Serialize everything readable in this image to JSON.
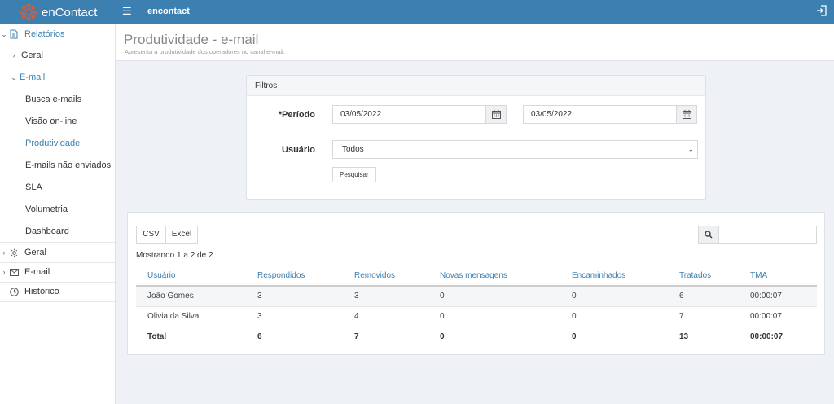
{
  "app": {
    "brand": "enContact",
    "title": "encontact"
  },
  "sidebar": {
    "reports": "Relatórios",
    "geral_sub": "Geral",
    "email_sub": "E-mail",
    "email_items": [
      "Busca e-mails",
      "Visão on-line",
      "Produtividade",
      "E-mails não enviados",
      "SLA",
      "Volumetria",
      "Dashboard"
    ],
    "geral": "Geral",
    "email": "E-mail",
    "historico": "Histórico"
  },
  "page": {
    "title": "Produtividade - e-mail",
    "subtitle": "Apresenta a produtividade dos operadores no canal e-mail."
  },
  "filters": {
    "heading": "Filtros",
    "period_label": "*Período",
    "date_from": "03/05/2022",
    "date_to": "03/05/2022",
    "user_label": "Usuário",
    "user_value": "Todos",
    "search_button": "Pesquisar"
  },
  "results": {
    "csv": "CSV",
    "excel": "Excel",
    "showing": "Mostrando 1 a 2 de 2",
    "columns": [
      "Usuário",
      "Respondidos",
      "Removidos",
      "Novas mensagens",
      "Encaminhados",
      "Tratados",
      "TMA"
    ],
    "rows": [
      [
        "João Gomes",
        "3",
        "3",
        "0",
        "0",
        "6",
        "00:00:07"
      ],
      [
        "Olivia da Silva",
        "3",
        "4",
        "0",
        "0",
        "7",
        "00:00:07"
      ]
    ],
    "total": [
      "Total",
      "6",
      "7",
      "0",
      "0",
      "13",
      "00:00:07"
    ]
  },
  "colors": {
    "accent": "#3c7fb1",
    "logo": "#e05a2b"
  }
}
